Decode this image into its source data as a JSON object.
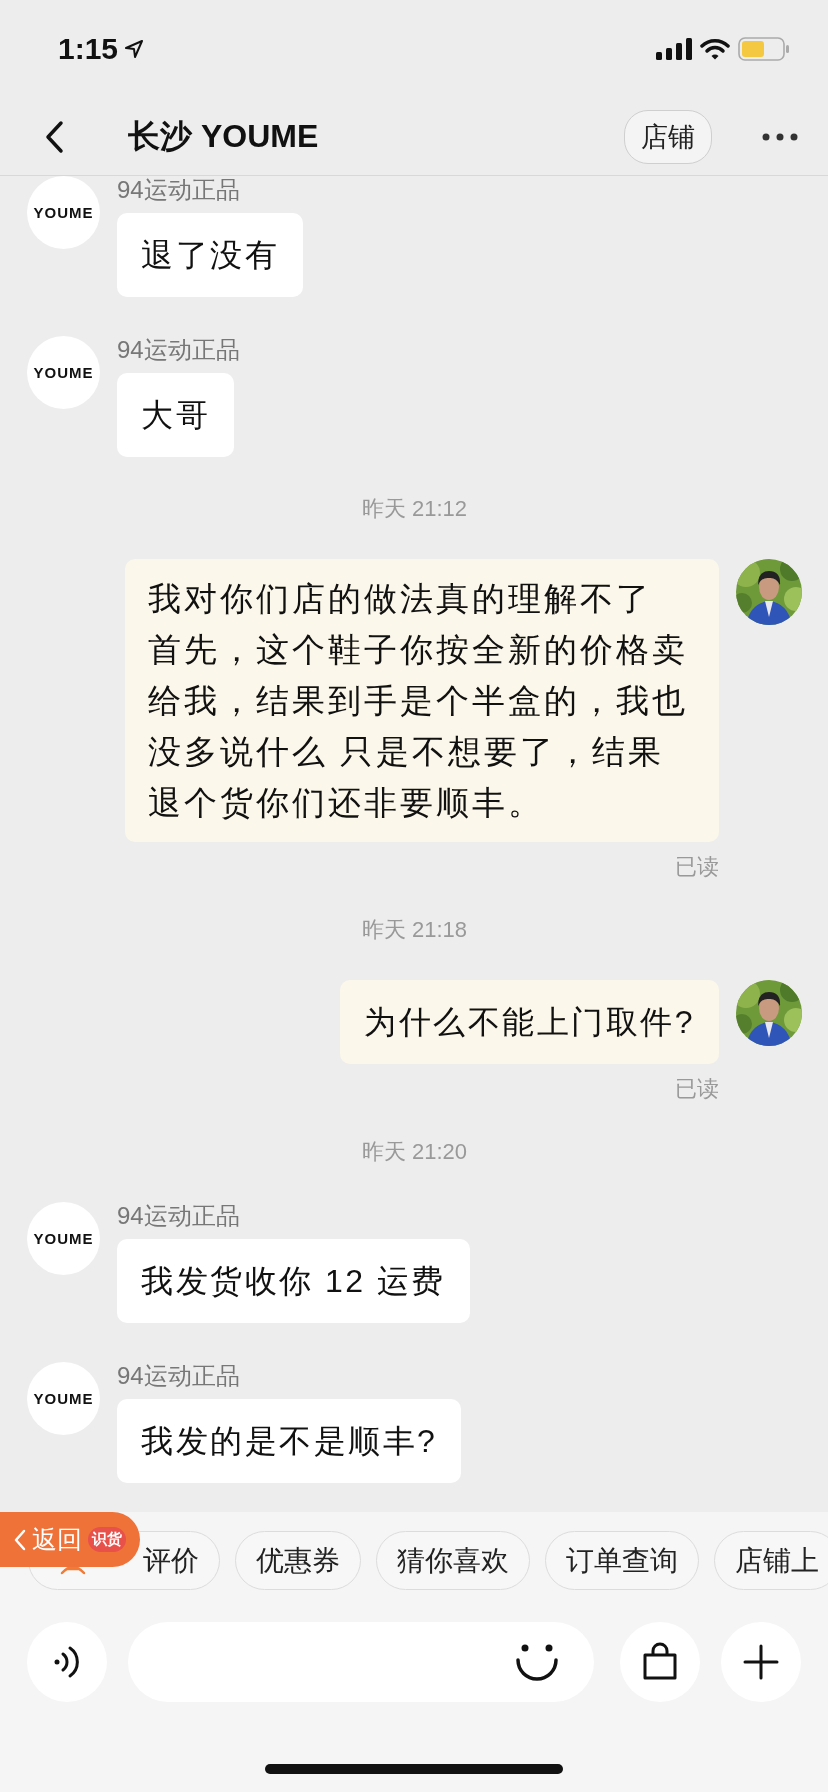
{
  "status_bar": {
    "time": "1:15"
  },
  "header": {
    "title": "长沙 YOUME",
    "store_button": "店铺"
  },
  "messages": [
    {
      "kind": "incoming",
      "avatar": "YOUME",
      "sender": "94运动正品",
      "text": "退了没有"
    },
    {
      "kind": "incoming",
      "avatar": "YOUME",
      "sender": "94运动正品",
      "text": "大哥"
    },
    {
      "kind": "time",
      "text": "昨天 21:12"
    },
    {
      "kind": "outgoing",
      "paragraphs": [
        "我对你们店的做法真的理解不了",
        "首先，这个鞋子你按全新的价格卖给我，结果到手是个半盒的，我也没多说什么 只是不想要了，结果退个货你们还非要顺丰。"
      ],
      "status": "已读"
    },
    {
      "kind": "time",
      "text": "昨天 21:18"
    },
    {
      "kind": "outgoing",
      "text": "为什么不能上门取件?",
      "status": "已读"
    },
    {
      "kind": "time",
      "text": "昨天 21:20"
    },
    {
      "kind": "incoming",
      "avatar": "YOUME",
      "sender": "94运动正品",
      "text": "我发货收你 12 运费"
    },
    {
      "kind": "incoming",
      "avatar": "YOUME",
      "sender": "94运动正品",
      "text": "我发的是不是顺丰?"
    }
  ],
  "quick_replies": [
    {
      "label": "评价",
      "icon": true
    },
    {
      "label": "优惠券",
      "icon": false
    },
    {
      "label": "猜你喜欢",
      "icon": false
    },
    {
      "label": "订单查询",
      "icon": false
    },
    {
      "label": "店铺上",
      "icon": false
    }
  ],
  "return_overlay": {
    "label": "返回",
    "app": "识货"
  }
}
